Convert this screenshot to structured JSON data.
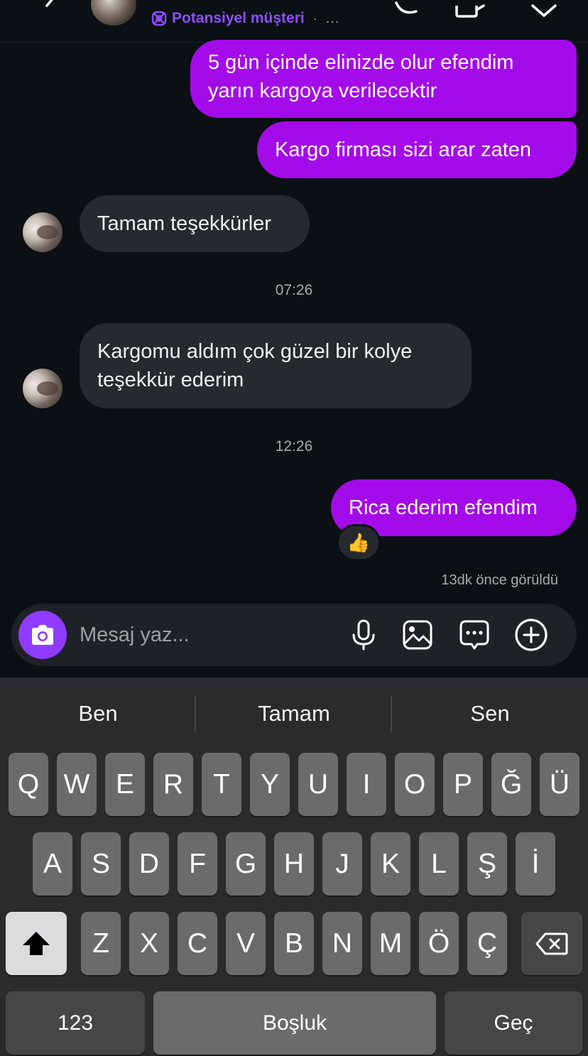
{
  "header": {
    "label": "Potansiyel müşteri",
    "separator": "·",
    "more": "..."
  },
  "messages": [
    {
      "direction": "outgoing",
      "text_line1": "5 gün içinde elinizde olur efendim",
      "text_line2": "yarın kargoya verilecektir"
    },
    {
      "direction": "outgoing",
      "text": "Kargo firması sizi arar zaten"
    },
    {
      "direction": "incoming",
      "text": "Tamam teşekkürler"
    },
    {
      "direction": "incoming",
      "text_line1": "Kargomu aldım çok güzel bir kolye",
      "text_line2": "teşekkür ederim"
    },
    {
      "direction": "outgoing",
      "text": "Rica ederim efendim",
      "reaction": "👍"
    }
  ],
  "timestamps": [
    "07:26",
    "12:26"
  ],
  "seen_status": "13dk önce görüldü",
  "composer": {
    "placeholder": "Mesaj yaz...",
    "icons": [
      "camera-icon",
      "microphone-icon",
      "image-icon",
      "chat-bubble-icon",
      "plus-circle-icon"
    ],
    "accent": "#8f3bff"
  },
  "keyboard": {
    "suggestions": [
      "Ben",
      "Tamam",
      "Sen"
    ],
    "row1": [
      "Q",
      "W",
      "E",
      "R",
      "T",
      "Y",
      "U",
      "I",
      "O",
      "P",
      "Ğ",
      "Ü"
    ],
    "row2": [
      "A",
      "S",
      "D",
      "F",
      "G",
      "H",
      "J",
      "K",
      "L",
      "Ş",
      "İ"
    ],
    "row3": [
      "Z",
      "X",
      "C",
      "V",
      "B",
      "N",
      "M",
      "Ö",
      "Ç"
    ],
    "numbers_label": "123",
    "space_label": "Boşluk",
    "return_label": "Geç"
  },
  "colors": {
    "outgoing_bubble": "#a40bea",
    "incoming_bubble": "#262a2f",
    "background": "#0b1014",
    "label_purple": "#8f4dff"
  }
}
